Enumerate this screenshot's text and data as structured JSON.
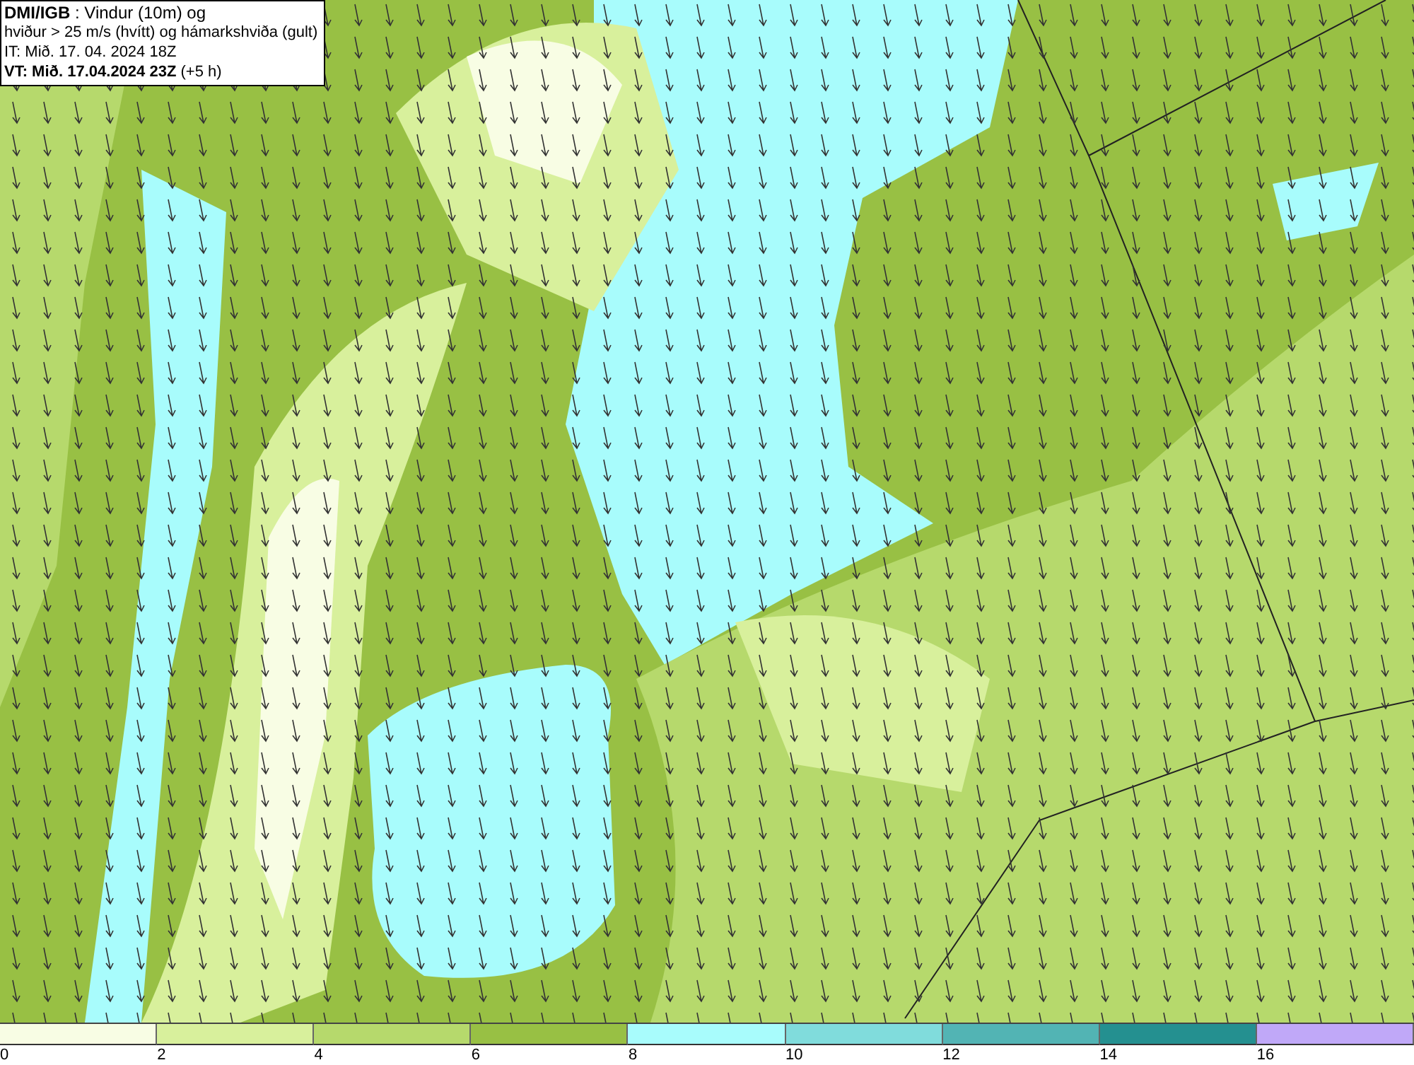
{
  "header": {
    "lines": [
      "**DMI/IGB** : Vindur (10m) og",
      "hviður > 25 m/s (hvítt) og hámarkshviða (gult)",
      "IT: Mið. 17. 04. 2024 18Z",
      "**VT: Mið. 17.04.2024 23Z** (+5 h)"
    ]
  },
  "legend": {
    "bands": [
      {
        "label": "0",
        "color": "#f8fde4"
      },
      {
        "label": "2",
        "color": "#d8f09c"
      },
      {
        "label": "4",
        "color": "#b6d96c"
      },
      {
        "label": "6",
        "color": "#98c044"
      },
      {
        "label": "8",
        "color": "#a8fcfc"
      },
      {
        "label": "10",
        "color": "#80dcdc"
      },
      {
        "label": "12",
        "color": "#52b4b4"
      },
      {
        "label": "14",
        "color": "#249090"
      },
      {
        "label": "16",
        "color": "#c0a8f8"
      }
    ]
  }
}
